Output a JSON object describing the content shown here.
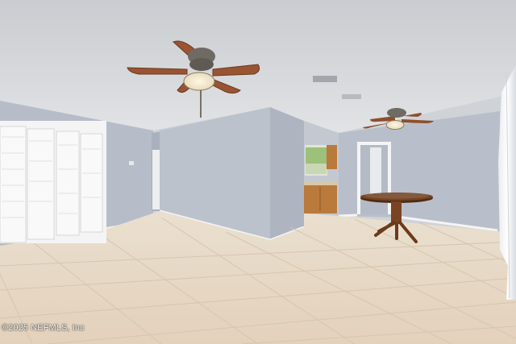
{
  "photo": {
    "watermark": "©2025 NEFMLS, Inc",
    "colors": {
      "ceiling": "#d8dbde",
      "wall": "#b9bfca",
      "wall_light": "#c5cad3",
      "baseboard": "#f2f2f2",
      "tile": "#e6d7c4",
      "grout": "#cdbca6",
      "cabinet": "#b97a3c",
      "fan_blade": "#9a5432",
      "table_wood": "#7a4321",
      "door": "#f5f5f5"
    },
    "objects": [
      "ceiling-fan",
      "ceiling-fan",
      "closet-bifold-doors",
      "kitchen-cabinets",
      "window",
      "round-pedestal-table",
      "white-curtain",
      "hvac-vent"
    ]
  }
}
